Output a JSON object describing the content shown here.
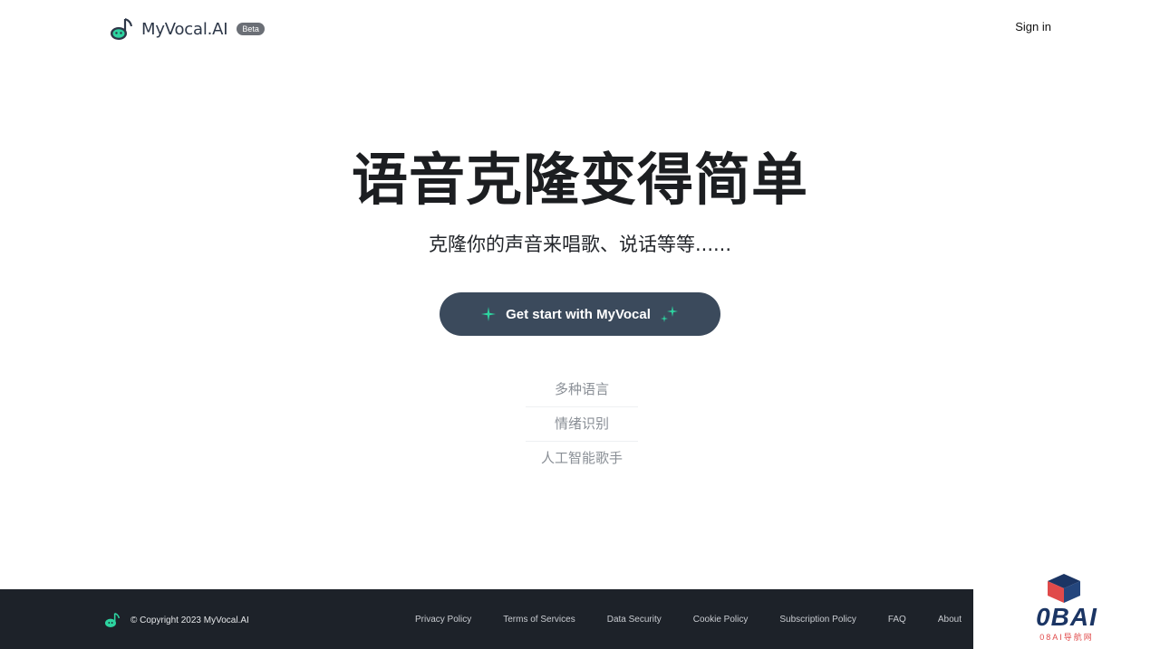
{
  "header": {
    "brand": "MyVocal.AI",
    "badge": "Beta",
    "sign_in": "Sign in"
  },
  "hero": {
    "title": "语音克隆变得简单",
    "subtitle": "克隆你的声音来唱歌、说话等等......",
    "cta_label": "Get start with MyVocal"
  },
  "features": [
    "多种语言",
    "情绪识别",
    "人工智能歌手"
  ],
  "footer": {
    "copyright": "© Copyright 2023 MyVocal.AI",
    "links": [
      "Privacy Policy",
      "Terms of Services",
      "Data Security",
      "Cookie Policy",
      "Subscription Policy",
      "FAQ",
      "About"
    ]
  },
  "watermark": {
    "text": "0BAI",
    "sub": "08AI导航网"
  },
  "colors": {
    "cta_bg": "#3b4a5c",
    "accent": "#2dd4a0",
    "footer_bg": "#1d2229"
  }
}
